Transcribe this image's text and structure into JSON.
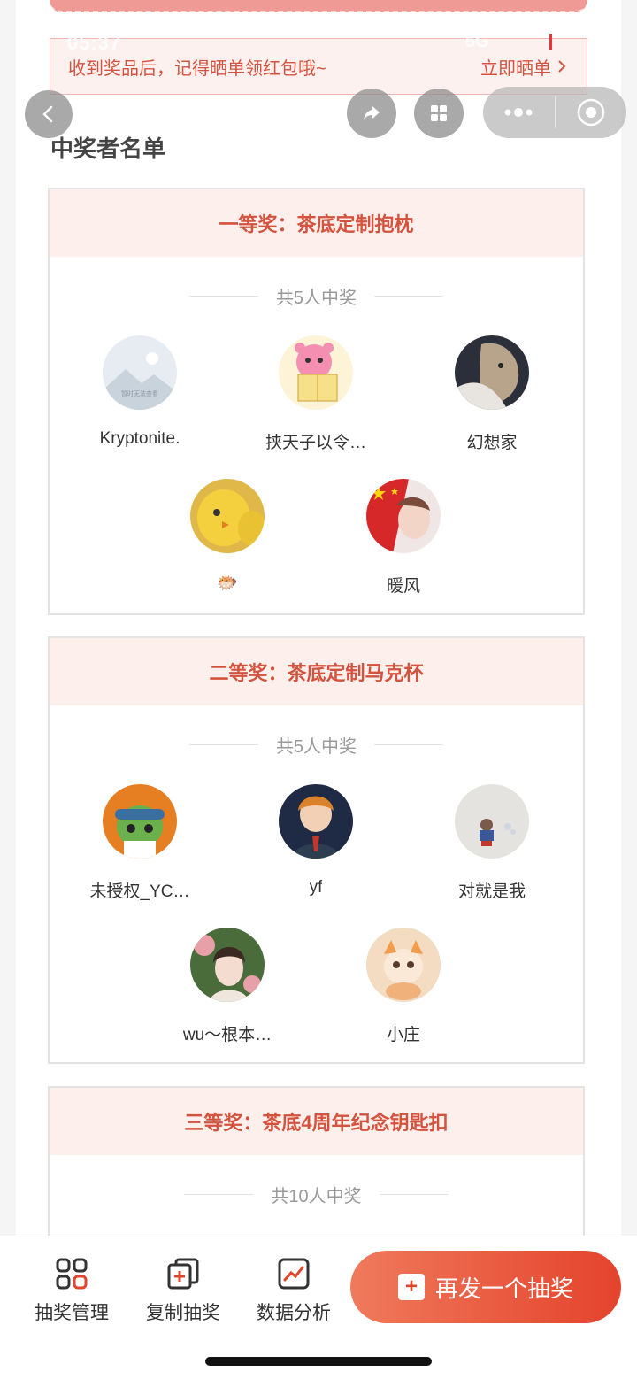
{
  "status": {
    "time": "05:37",
    "right": "5G"
  },
  "notice": {
    "text": "收到奖品后，记得晒单领红包哦~",
    "link": "立即晒单"
  },
  "nav": {
    "back_icon": "chevron-left-icon",
    "share_icon": "share-icon",
    "grid_icon": "grid-icon",
    "more_icon": "more-dots-icon",
    "close_icon": "target-icon"
  },
  "section_title": "中奖者名单",
  "prizes": [
    {
      "title": "一等奖：茶底定制抱枕",
      "count": "共5人中奖",
      "winners": [
        {
          "name": "Kryptonite."
        },
        {
          "name": "挟天子以令…"
        },
        {
          "name": "幻想家"
        },
        {
          "name": "🐡"
        },
        {
          "name": "暖风"
        }
      ]
    },
    {
      "title": "二等奖：茶底定制马克杯",
      "count": "共5人中奖",
      "winners": [
        {
          "name": "未授权_YC…"
        },
        {
          "name": "yf"
        },
        {
          "name": "对就是我"
        },
        {
          "name": "wu～根本…"
        },
        {
          "name": "小庄"
        }
      ]
    },
    {
      "title": "三等奖：茶底4周年纪念钥匙扣",
      "count": "共10人中奖",
      "winners": []
    }
  ],
  "avatar_placeholder_text": "暂时无法查看",
  "bottom_tabs": [
    {
      "label": "抽奖管理",
      "icon": "apps-grid-icon"
    },
    {
      "label": "复制抽奖",
      "icon": "copy-add-icon"
    },
    {
      "label": "数据分析",
      "icon": "chart-trend-icon"
    }
  ],
  "cta": {
    "label": "再发一个抽奖",
    "icon": "plus-icon"
  },
  "colors": {
    "accent": "#d4533f",
    "cta_start": "#ef7a5c",
    "cta_end": "#e4432c",
    "head_bg": "#fdefec"
  }
}
